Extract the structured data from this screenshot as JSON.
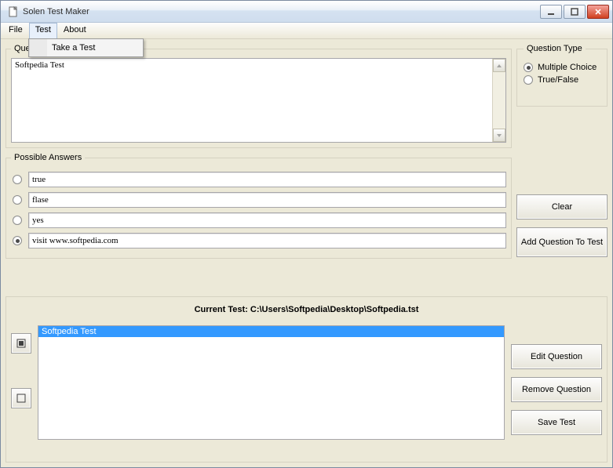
{
  "window": {
    "title": "Solen Test Maker"
  },
  "menu": {
    "items": [
      "File",
      "Test",
      "About"
    ],
    "active_index": 1,
    "dropdown": {
      "items": [
        "Take a Test"
      ]
    }
  },
  "question_group": {
    "legend": "Question",
    "text": "Softpedia Test"
  },
  "question_type": {
    "legend": "Question Type",
    "options": [
      {
        "label": "Multiple Choice",
        "checked": true
      },
      {
        "label": "True/False",
        "checked": false
      }
    ]
  },
  "answers": {
    "legend": "Possible Answers",
    "rows": [
      {
        "value": "true",
        "checked": false
      },
      {
        "value": "flase",
        "checked": false
      },
      {
        "value": "yes",
        "checked": false
      },
      {
        "value": "visit www.softpedia.com",
        "checked": true
      }
    ]
  },
  "buttons": {
    "clear": "Clear",
    "add_q": "Add Question To Test",
    "edit_q": "Edit Question",
    "remove_q": "Remove Question",
    "save_test": "Save Test"
  },
  "current_test": {
    "label_prefix": "Current Test: ",
    "path": "C:\\Users\\Softpedia\\Desktop\\Softpedia.tst",
    "items": [
      {
        "text": "Softpedia Test",
        "selected": true
      }
    ]
  }
}
